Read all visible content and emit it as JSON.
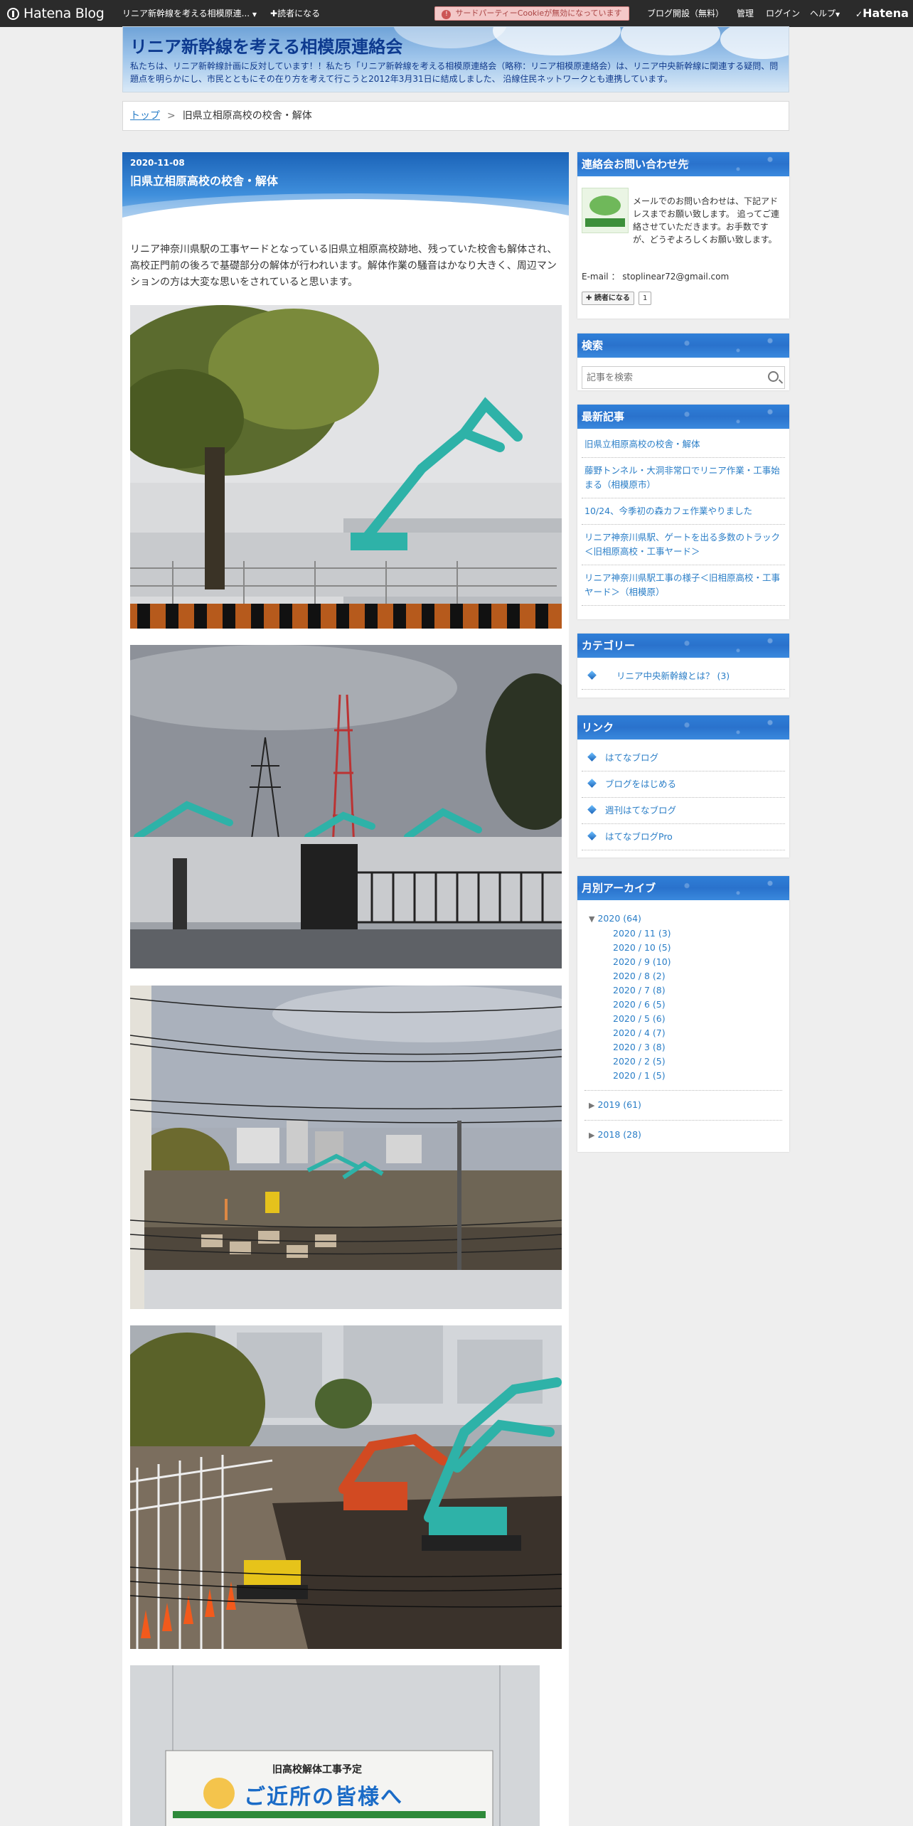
{
  "globalbar": {
    "logo": "Hatena Blog",
    "blog_selector": "リニア新幹線を考える相模原連...",
    "reader_button": "読者になる",
    "cookie_notice": "サードパーティーCookieが無効になっています",
    "open_blog": "ブログ開設（無料）",
    "admin": "管理",
    "login": "ログイン",
    "help": "ヘルプ",
    "hatena": "Hatena"
  },
  "header": {
    "title": "リニア新幹線を考える相模原連絡会",
    "description": "私たちは、リニア新幹線計画に反対しています！！私たち「リニア新幹線を考える相模原連絡会（略称：リニア相模原連絡会）は、リニア中央新幹線に関連する疑問、問題点を明らかにし、市民とともにその在り方を考えて行こうと2012年3月31日に結成しました、 沿線住民ネットワークとも連携しています。"
  },
  "breadcrumb": {
    "home": "トップ",
    "separator": ">",
    "current": "旧県立相原高校の校舎・解体"
  },
  "entry": {
    "date": "2020-11-08",
    "title": "旧県立相原高校の校舎・解体",
    "body": "リニア神奈川県駅の工事ヤードとなっている旧県立相原高校跡地、残っていた校舎も解体され、高校正門前の後ろで基礎部分の解体が行われいます。解体作業の騒音はかなり大きく、周辺マンションの方は大変な思いをされていると思います。",
    "sign_top": "旧高校解体工事予定",
    "sign_main": "ご近所の皆様へ"
  },
  "sidebar": {
    "contact": {
      "title": "連絡会お問い合わせ先",
      "text": "メールでのお問い合わせは、下記アドレスまでお願い致します。 追ってご連絡させていただきます。お手数ですが、どうぞよろしくお願い致します。",
      "email": "E-mail ： stoplinear72@gmail.com",
      "subscribe": "読者になる",
      "subscribe_count": "1"
    },
    "search": {
      "title": "検索",
      "placeholder": "記事を検索"
    },
    "recent": {
      "title": "最新記事",
      "items": [
        "旧県立相原高校の校舎・解体",
        "藤野トンネル・大洞非常口でリニア作業・工事始まる（相模原市）",
        "10/24、今季初の森カフェ作業やりました",
        "リニア神奈川県駅、ゲートを出る多数のトラック＜旧相原高校・工事ヤード＞",
        "リニア神奈川県駅工事の様子＜旧相原高校・工事ヤード＞（相模原）"
      ]
    },
    "category": {
      "title": "カテゴリー",
      "items": [
        "リニア中央新幹線とは？ (3)"
      ]
    },
    "links": {
      "title": "リンク",
      "items": [
        "はてなブログ",
        "ブログをはじめる",
        "週刊はてなブログ",
        "はてなブログPro"
      ]
    },
    "archive": {
      "title": "月別アーカイブ",
      "year_2020": "2020 (64)",
      "months": [
        "2020 / 11 (3)",
        "2020 / 10 (5)",
        "2020 / 9 (10)",
        "2020 / 8 (2)",
        "2020 / 7 (8)",
        "2020 / 6 (5)",
        "2020 / 5 (6)",
        "2020 / 4 (7)",
        "2020 / 3 (8)",
        "2020 / 2 (5)",
        "2020 / 1 (5)"
      ],
      "year_2019": "2019 (61)",
      "year_2018": "2018 (28)"
    }
  }
}
